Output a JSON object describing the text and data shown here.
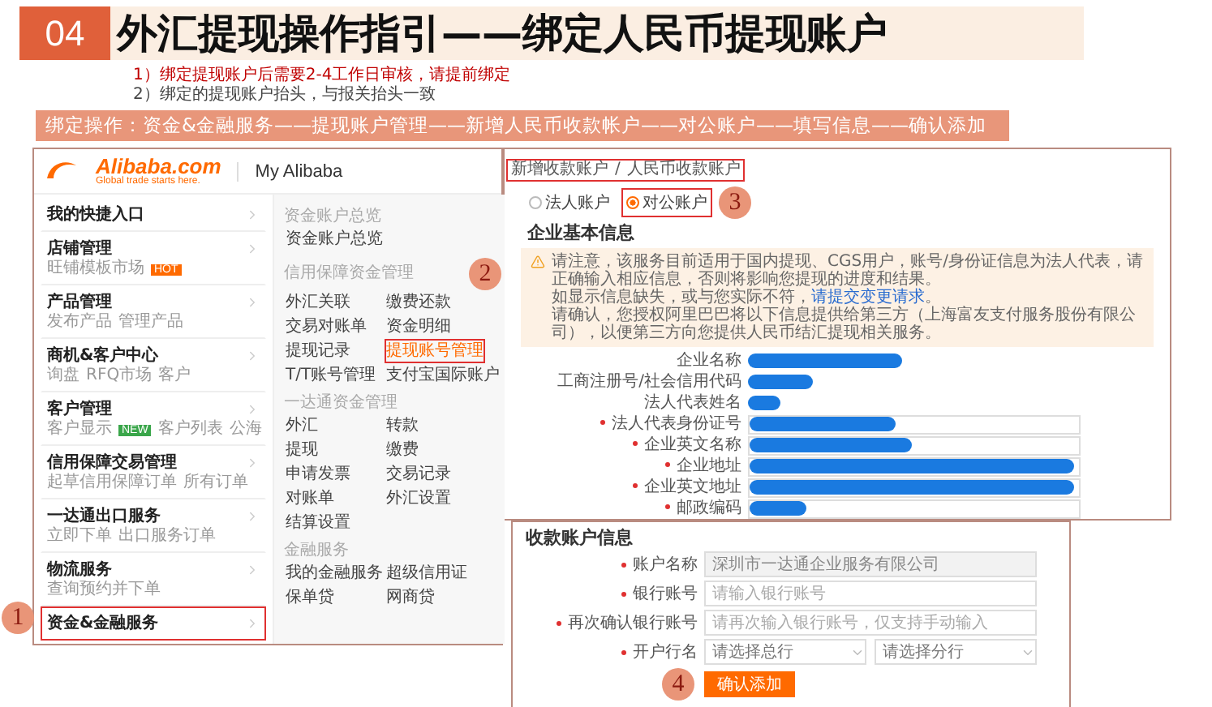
{
  "header": {
    "number": "04",
    "title": "外汇提现操作指引——绑定人民币提现账户"
  },
  "notes": [
    {
      "text": "1）绑定提现账户后需要2-4工作日审核，请提前绑定",
      "highlighted": true
    },
    {
      "text": "2）绑定的提现账户抬头，与报关抬头一致",
      "highlighted": false
    }
  ],
  "steps_bar": "绑定操作：资金&金融服务——提现账户管理——新增人民币收款帐户——对公账户——填写信息——确认添加",
  "alibaba": {
    "logo": "Alibaba.com",
    "tagline": "Global trade starts here.",
    "title": "My Alibaba",
    "menu": [
      {
        "title": "我的快捷入口",
        "selected": false
      },
      {
        "title": "店铺管理",
        "links": [
          "旺铺模板市场"
        ],
        "badge": {
          "text": "HOT",
          "kind": "hot"
        },
        "selected": false
      },
      {
        "title": "产品管理",
        "links": [
          "发布产品",
          "管理产品"
        ],
        "selected": false
      },
      {
        "title": "商机&客户中心",
        "links": [
          "询盘",
          "RFQ市场",
          "客户"
        ],
        "selected": false
      },
      {
        "title": "客户管理",
        "links": [
          "客户显示",
          "客户列表",
          "公海"
        ],
        "badge": {
          "text": "NEW",
          "kind": "new"
        },
        "selected": false
      },
      {
        "title": "信用保障交易管理",
        "links": [
          "起草信用保障订单",
          "所有订单"
        ],
        "selected": false
      },
      {
        "title": "一达通出口服务",
        "links": [
          "立即下单",
          "出口服务订单"
        ],
        "selected": false
      },
      {
        "title": "物流服务",
        "links": [
          "查询预约并下单"
        ],
        "selected": false
      },
      {
        "title": "资金&金融服务",
        "selected": true,
        "step": "1"
      }
    ],
    "sections": [
      {
        "heading": "资金账户总览",
        "links": [
          {
            "text": "资金账户总览",
            "selected": false
          }
        ]
      },
      {
        "heading": "信用保障资金管理",
        "links": [
          {
            "text": "外汇关联",
            "selected": false
          },
          {
            "text": "缴费还款",
            "selected": false
          },
          {
            "text": "交易对账单",
            "selected": false
          },
          {
            "text": "资金明细",
            "selected": false
          },
          {
            "text": "提现记录",
            "selected": false
          },
          {
            "text": "提现账号管理",
            "selected": true,
            "step": "2"
          },
          {
            "text": "T/T账号管理",
            "selected": false
          },
          {
            "text": "支付宝国际账户",
            "selected": false
          }
        ]
      },
      {
        "heading": "一达通资金管理",
        "links": [
          {
            "text": "外汇",
            "selected": false
          },
          {
            "text": "转款",
            "selected": false
          },
          {
            "text": "提现",
            "selected": false
          },
          {
            "text": "缴费",
            "selected": false
          },
          {
            "text": "申请发票",
            "selected": false
          },
          {
            "text": "交易记录",
            "selected": false
          },
          {
            "text": "对账单",
            "selected": false
          },
          {
            "text": "外汇设置",
            "selected": false
          },
          {
            "text": "结算设置",
            "selected": false
          }
        ]
      },
      {
        "heading": "金融服务",
        "links": [
          {
            "text": "我的金融服务",
            "selected": false
          },
          {
            "text": "超级信用证",
            "selected": false
          },
          {
            "text": "保单贷",
            "selected": false
          },
          {
            "text": "网商贷",
            "selected": false
          }
        ]
      }
    ]
  },
  "account_page": {
    "breadcrumb": [
      "新增收款账户",
      "人民币收款账户"
    ],
    "breadcrumb_separator": "/",
    "account_types": [
      {
        "label": "法人账户",
        "selected": false
      },
      {
        "label": "对公账户",
        "selected": true,
        "step": "3"
      }
    ],
    "section_title": "企业基本信息",
    "notice": {
      "line_1": "请注意，该服务目前适用于国内提现、CGS用户，账号/身份证信息为法人代表，请正确输入相应信息，否则将影响您提现的进度和结果。",
      "line_2_before": "如显示信息缺失，或与您实际不符，",
      "line_2_link": "请提交变更请求",
      "line_2_after": "。",
      "line_3": "请确认，您授权阿里巴巴将以下信息提供给第三方（上海富友支付服务股份有限公司），以便第三方向您提供人民币结汇提现相关服务。"
    },
    "fields": [
      {
        "label": "企业名称",
        "required": false,
        "kind": "text"
      },
      {
        "label": "工商注册号/社会信用代码",
        "required": false,
        "kind": "text"
      },
      {
        "label": "法人代表姓名",
        "required": false,
        "kind": "text"
      },
      {
        "label": "法人代表身份证号",
        "required": true,
        "kind": "input"
      },
      {
        "label": "企业英文名称",
        "required": true,
        "kind": "input"
      },
      {
        "label": "企业地址",
        "required": true,
        "kind": "input"
      },
      {
        "label": "企业英文地址",
        "required": true,
        "kind": "input"
      },
      {
        "label": "邮政编码",
        "required": true,
        "kind": "input"
      }
    ]
  },
  "payee_form": {
    "title": "收款账户信息",
    "fields": [
      {
        "label": "账户名称",
        "required": true,
        "kind": "input",
        "value": "深圳市一达通企业服务有限公司",
        "disabled": true
      },
      {
        "label": "银行账号",
        "required": true,
        "kind": "input",
        "placeholder": "请输入银行账号",
        "disabled": false
      },
      {
        "label": "再次确认银行账号",
        "required": true,
        "kind": "input",
        "placeholder": "请再次输入银行账号，仅支持手动输入",
        "disabled": false
      },
      {
        "label": "开户行名",
        "required": true,
        "kind": "select",
        "selects": [
          {
            "placeholder": "请选择总行"
          },
          {
            "placeholder": "请选择分行"
          }
        ]
      }
    ],
    "button": "确认添加",
    "step": "4"
  }
}
